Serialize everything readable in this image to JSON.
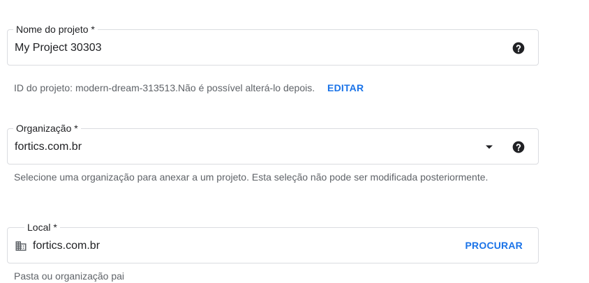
{
  "project_name": {
    "label": "Nome do projeto *",
    "value": "My Project 30303",
    "help_icon": "help-circle-icon"
  },
  "project_id": {
    "text": "ID do projeto: modern-dream-313513.Não é possível alterá-lo depois.",
    "edit_label": "EDITAR"
  },
  "organization": {
    "label": "Organização *",
    "value": "fortics.com.br",
    "dropdown_icon": "arrow-drop-down-icon",
    "help_icon": "help-circle-icon",
    "hint": "Selecione uma organização para anexar a um projeto. Esta seleção não pode ser modificada posteriormente."
  },
  "location": {
    "label": "Local *",
    "value": "fortics.com.br",
    "icon": "domain-icon",
    "browse_label": "PROCURAR",
    "hint": "Pasta ou organização pai"
  },
  "colors": {
    "accent": "#1a73e8",
    "text": "#202124",
    "secondary_text": "#5f6368",
    "border": "#dadce0"
  }
}
